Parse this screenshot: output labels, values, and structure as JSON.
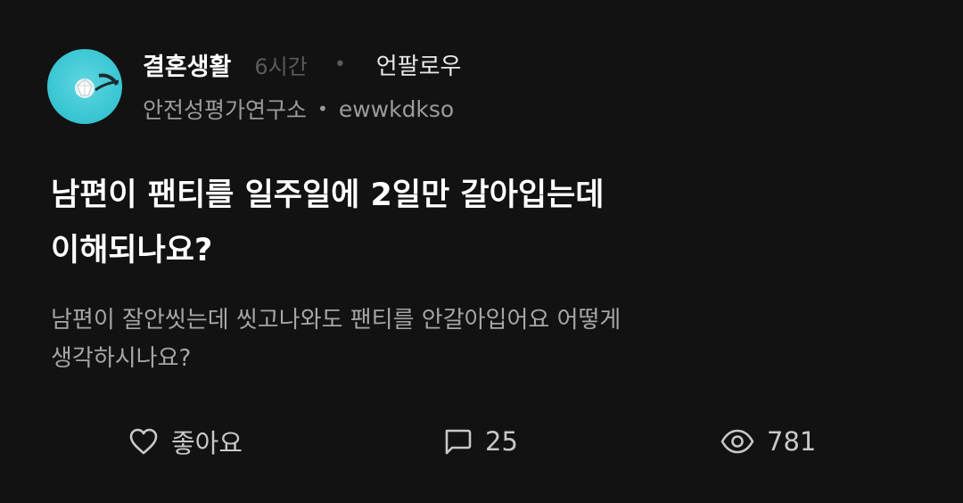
{
  "post": {
    "category": "결혼생활",
    "time": "6시간",
    "separator": "•",
    "follow_label": "언팔로우",
    "company": "안전성평가연구소",
    "username": "ewwkdkso",
    "title_lines": [
      "남편이 팬티를 일주일에 2일만 갈아입는데",
      "이해되나요?"
    ],
    "body_lines": [
      "남편이 잘안씻는데 씻고나와도 팬티를 안갈아입어요 어떻게",
      "생각하시나요?"
    ]
  },
  "actions": {
    "like_label": "좋아요",
    "comment_count": "25",
    "view_count": "781"
  },
  "icons": {
    "like": "heart-outline-icon",
    "comment": "chat-bubble-icon",
    "views": "eye-icon"
  },
  "colors": {
    "background": "#121212",
    "avatar_bg": "#3cc7d4",
    "primary_text": "#ffffff",
    "secondary_text": "#9b9b9b",
    "muted_text": "#5a5a5a"
  }
}
